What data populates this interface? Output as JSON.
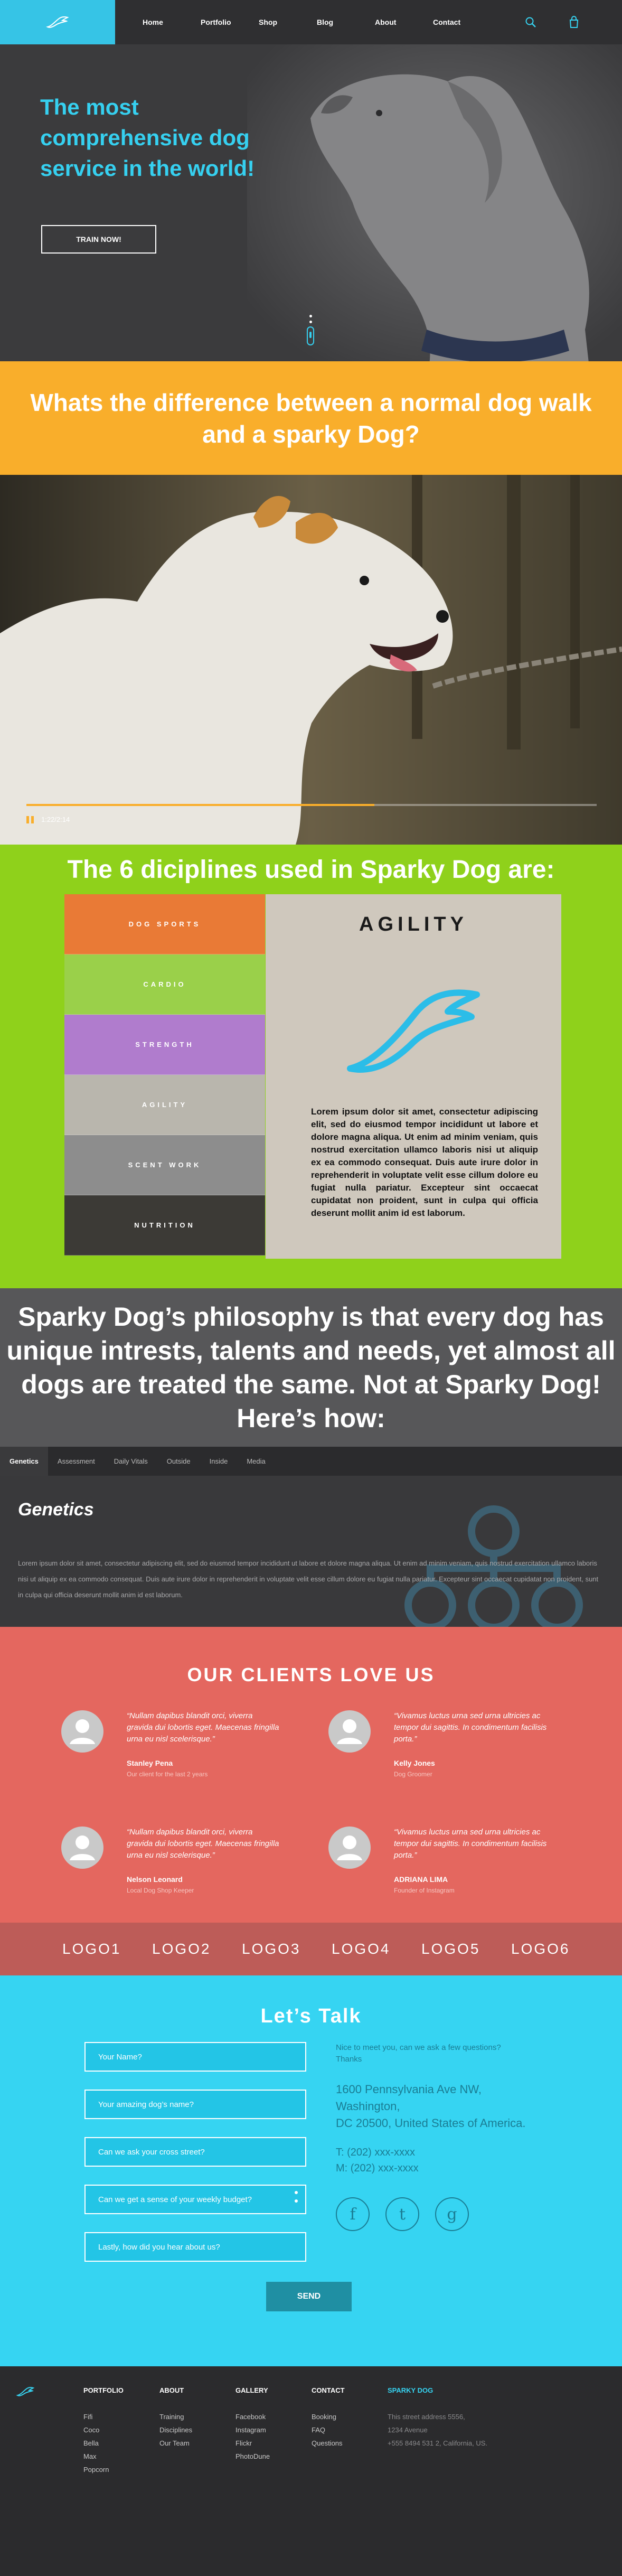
{
  "header": {
    "nav": [
      "Home",
      "Portfolio",
      "Shop",
      "Blog",
      "About",
      "Contact"
    ]
  },
  "icons": {
    "logo": "wing-logo-icon",
    "search": "search-icon",
    "cart": "cart-icon"
  },
  "hero": {
    "title": "The most comprehensive dog service in the world!",
    "button": "TRAIN NOW!"
  },
  "difference": {
    "title": "Whats the difference between a normal dog walk and a sparky Dog?"
  },
  "video": {
    "time": "1:22/2:14",
    "progress": 0.61
  },
  "disciplines": {
    "title": "The 6 diciplines used in Sparky Dog are:",
    "items": [
      "DOG SPORTS",
      "CARDIO",
      "STRENGTH",
      "AGILITY",
      "SCENT WORK",
      "NUTRITION"
    ],
    "panel_title": "AGILITY",
    "panel_text": "Lorem ipsum dolor sit amet, consectetur adipiscing elit, sed do eiusmod tempor incididunt ut labore et dolore magna aliqua. Ut enim ad minim veniam, quis nostrud exercitation ullamco laboris nisi ut aliquip ex ea commodo consequat. Duis aute irure dolor in reprehenderit in voluptate velit esse cillum dolore eu fugiat nulla pariatur. Excepteur sint occaecat cupidatat non proident, sunt in culpa qui officia deserunt mollit anim id est laborum."
  },
  "philosophy": {
    "title": "Sparky Dog’s philosophy is that every dog has unique intrests, talents and needs, yet almost all dogs are treated the same. Not at Sparky Dog! Here’s how:"
  },
  "tabs": {
    "items": [
      "Genetics",
      "Assessment",
      "Daily Vitals",
      "Outside",
      "Inside",
      "Media"
    ],
    "active_title": "Genetics",
    "active_text": "Lorem ipsum dolor sit amet, consectetur adipiscing elit, sed do eiusmod tempor incididunt ut labore et dolore magna aliqua. Ut enim ad minim veniam, quis nostrud exercitation ullamco laboris nisi ut aliquip ex ea commodo consequat. Duis aute irure dolor in reprehenderit in voluptate velit esse cillum dolore eu fugiat nulla pariatur. Excepteur sint occaecat cupidatat non proident, sunt in culpa qui officia deserunt mollit anim id est laborum."
  },
  "clients": {
    "title": "OUR CLIENTS LOVE US",
    "testimonials": [
      {
        "quote": "“Nullam dapibus blandit orci, viverra gravida dui lobortis eget. Maecenas fringilla urna eu nisl scelerisque.”",
        "name": "Stanley Pena",
        "role": "Our client for the last 2 years"
      },
      {
        "quote": "“Vivamus luctus urna sed urna ultricies ac tempor dui sagittis. In condimentum facilisis porta.”",
        "name": "Kelly Jones",
        "role": "Dog Groomer"
      },
      {
        "quote": "“Nullam dapibus blandit orci, viverra gravida dui lobortis eget. Maecenas fringilla urna eu nisl scelerisque.”",
        "name": "Nelson Leonard",
        "role": "Local Dog Shop Keeper"
      },
      {
        "quote": "“Vivamus luctus urna sed urna ultricies ac tempor dui sagittis. In condimentum facilisis porta.”",
        "name": "ADRIANA LIMA",
        "role": "Founder of Instagram"
      }
    ]
  },
  "logos": [
    "LOGO1",
    "LOGO2",
    "LOGO3",
    "LOGO4",
    "LOGO5",
    "LOGO6"
  ],
  "contact": {
    "title": "Let’s Talk",
    "fields": [
      "Your Name?",
      "Your amazing dog’s name?",
      "Can we ask your cross street?",
      "Can we get a sense of your weekly budget?",
      "Lastly, how did you hear about us?"
    ],
    "send": "SEND",
    "intro_line1": "Nice to meet you, can we ask a few questions?",
    "intro_line2": "Thanks",
    "address_line1": "1600 Pennsylvania Ave NW, Washington,",
    "address_line2": "DC 20500, United States of America.",
    "phone": "T: (202) xxx-xxxx",
    "mobile": "M: (202) xxx-xxxx",
    "socials": [
      "f",
      "t",
      "g"
    ]
  },
  "footer": {
    "columns": [
      {
        "heading": "PORTFOLIO",
        "links": [
          "Fifi",
          "Coco",
          "Bella",
          "Max",
          "Popcorn"
        ]
      },
      {
        "heading": "ABOUT",
        "links": [
          "Training",
          "Disciplines",
          "Our Team"
        ]
      },
      {
        "heading": "GALLERY",
        "links": [
          "Facebook",
          "Instagram",
          "Flickr",
          "PhotoDune"
        ]
      },
      {
        "heading": "CONTACT",
        "links": [
          "Booking",
          "FAQ",
          "Questions"
        ]
      },
      {
        "heading": "SPARKY DOG",
        "links": [
          "This street address 5556,",
          "1234 Avenue",
          "+555 8494 531 2, California, US."
        ]
      }
    ]
  },
  "colors": {
    "accent": "#36d4f2",
    "orange": "#f9ae2b",
    "green": "#8fd11b",
    "coral": "#e4675f",
    "dark": "#2b2b2d"
  }
}
